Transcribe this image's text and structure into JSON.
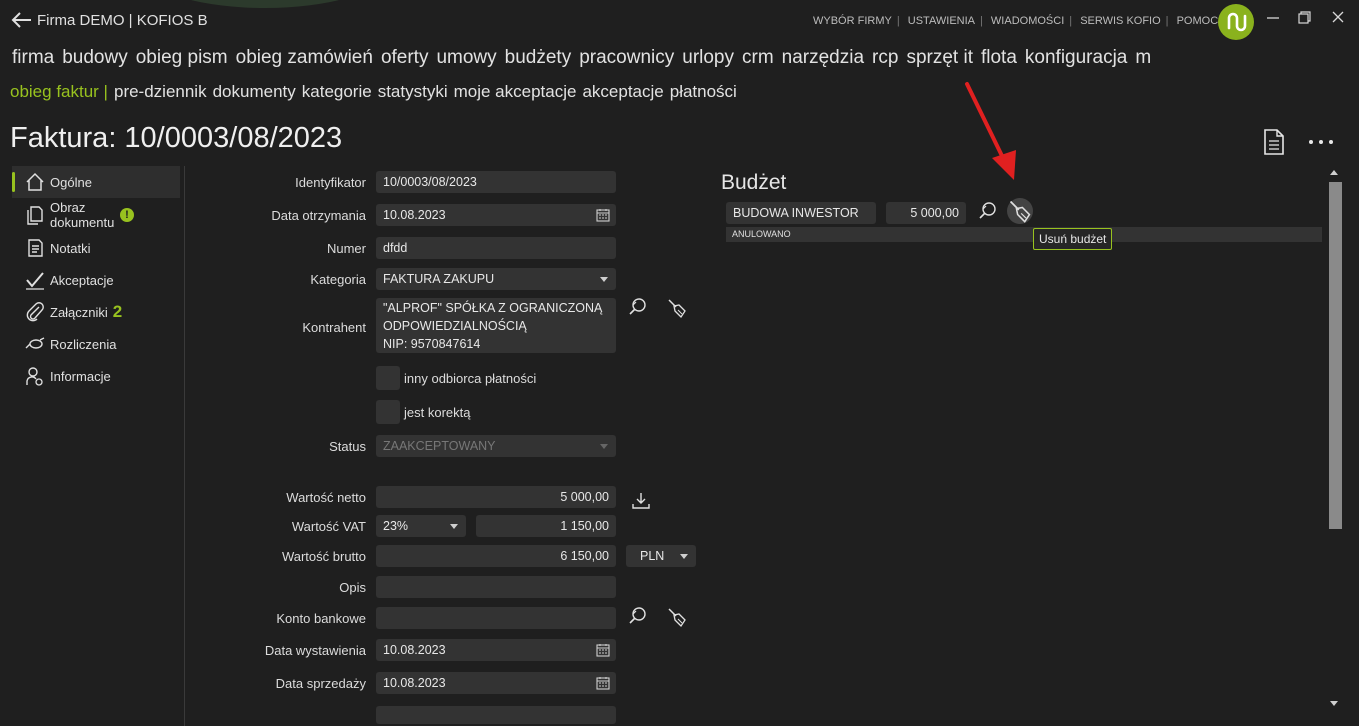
{
  "window": {
    "title": "Firma DEMO | KOFIOS B",
    "top_links": [
      "WYBÓR FIRMY",
      "USTAWIENIA",
      "WIADOMOŚCI",
      "SERWIS KOFIO",
      "POMOC"
    ]
  },
  "main_nav": [
    "firma",
    "budowy",
    "obieg pism",
    "obieg zamówień",
    "oferty",
    "umowy",
    "budżety",
    "pracownicy",
    "urlopy",
    "crm",
    "narzędzia",
    "rcp",
    "sprzęt it",
    "flota",
    "konfiguracja",
    "m"
  ],
  "sub_nav": {
    "active": "obieg faktur |",
    "items": [
      "pre-dziennik",
      "dokumenty",
      "kategorie",
      "statystyki",
      "moje akceptacje",
      "akceptacje",
      "płatności"
    ]
  },
  "page_title": "Faktura: 10/0003/08/2023",
  "sidebar": {
    "items": [
      {
        "label": "Ogólne"
      },
      {
        "label": "Obraz\ndokumentu",
        "badge": "!"
      },
      {
        "label": "Notatki"
      },
      {
        "label": "Akceptacje"
      },
      {
        "label": "Załączniki",
        "count": "2"
      },
      {
        "label": "Rozliczenia"
      },
      {
        "label": "Informacje"
      }
    ]
  },
  "form": {
    "identyfikator": {
      "label": "Identyfikator",
      "value": "10/0003/08/2023"
    },
    "data_otrzymania": {
      "label": "Data otrzymania",
      "value": "10.08.2023"
    },
    "numer": {
      "label": "Numer",
      "value": "dfdd"
    },
    "kategoria": {
      "label": "Kategoria",
      "value": "FAKTURA ZAKUPU"
    },
    "kontrahent": {
      "label": "Kontrahent",
      "line1": "\"ALPROF\" SPÓŁKA Z OGRANICZONĄ",
      "line2": "ODPOWIEDZIALNOŚCIĄ",
      "line3": "NIP: 9570847614"
    },
    "inny_odbiorca": {
      "label": "inny odbiorca płatności"
    },
    "korekta": {
      "label": "jest korektą"
    },
    "status": {
      "label": "Status",
      "value": "ZAAKCEPTOWANY"
    },
    "netto": {
      "label": "Wartość netto",
      "value": "5 000,00"
    },
    "vat": {
      "label": "Wartość VAT",
      "rate": "23%",
      "value": "1 150,00"
    },
    "brutto": {
      "label": "Wartość brutto",
      "value": "6 150,00",
      "currency": "PLN"
    },
    "opis": {
      "label": "Opis",
      "value": ""
    },
    "konto": {
      "label": "Konto bankowe",
      "value": ""
    },
    "data_wystawienia": {
      "label": "Data wystawienia",
      "value": "10.08.2023"
    },
    "data_sprzedazy": {
      "label": "Data sprzedaży",
      "value": "10.08.2023"
    }
  },
  "budget": {
    "title": "Budżet",
    "name": "BUDOWA INWESTOR",
    "amount": "5 000,00",
    "status": "ANULOWANO",
    "tooltip": "Usuń budżet"
  },
  "colors": {
    "accent": "#98c21f",
    "background": "#1f1f1f",
    "field": "#333333",
    "annotation": "#e02020"
  }
}
